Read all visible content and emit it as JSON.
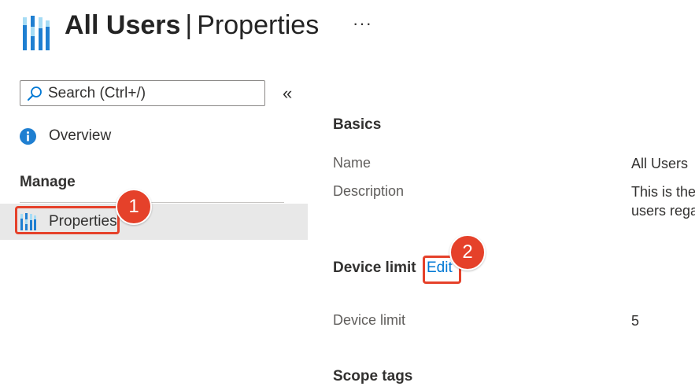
{
  "header": {
    "entity_name": "All Users",
    "separator": "|",
    "section_name": "Properties",
    "more_label": "···",
    "app_icon": "groups-bars-icon"
  },
  "sidebar": {
    "search": {
      "placeholder": "Search (Ctrl+/)",
      "value": ""
    },
    "collapse_label": "«",
    "overview": {
      "label": "Overview",
      "icon": "info-icon"
    },
    "manage_header": "Manage",
    "items": [
      {
        "label": "Properties",
        "icon": "groups-bars-icon",
        "selected": true
      }
    ]
  },
  "main": {
    "basics": {
      "title": "Basics",
      "rows": [
        {
          "label": "Name",
          "value": "All Users"
        },
        {
          "label": "Description",
          "value_lines": [
            "This is the",
            "users rega"
          ]
        }
      ]
    },
    "device_limit": {
      "title": "Device limit",
      "edit_label": "Edit",
      "rows": [
        {
          "label": "Device limit",
          "value": "5"
        }
      ]
    },
    "scope_tags": {
      "title": "Scope tags"
    }
  },
  "annotations": {
    "badge_1": "1",
    "badge_2": "2",
    "color": "#e5412a"
  },
  "colors": {
    "accent": "#0078d4",
    "selected_bg": "#e8e8e8"
  }
}
